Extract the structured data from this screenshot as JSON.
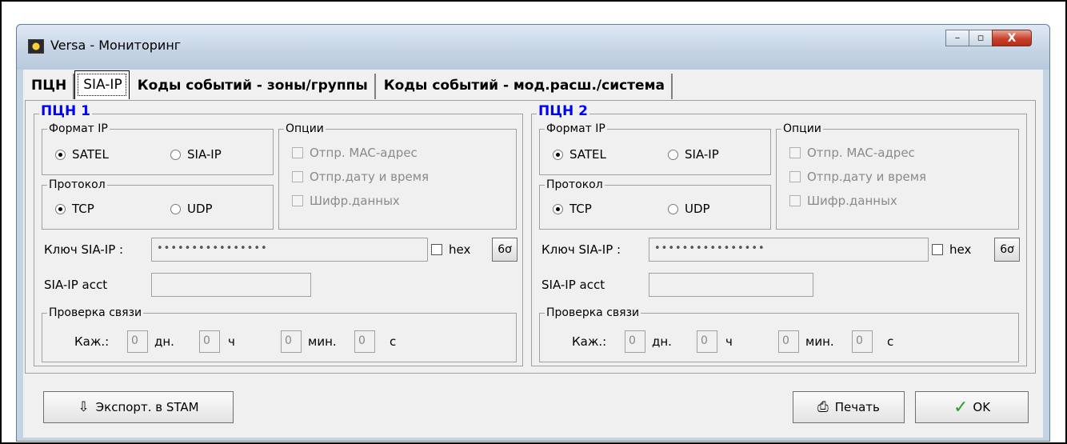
{
  "window": {
    "title": "Versa - Мониторинг",
    "minimize": "–",
    "maximize": "▫",
    "close": "X"
  },
  "tabs": [
    {
      "label": "ПЦН"
    },
    {
      "label": "SIA-IP"
    },
    {
      "label": "Коды событий - зоны/группы"
    },
    {
      "label": "Коды событий - мод.расш./система"
    }
  ],
  "stations": [
    {
      "title": "ПЦН 1",
      "format_group": "Формат IP",
      "format_options": [
        "SATEL",
        "SIA-IP"
      ],
      "protocol_group": "Протокол",
      "protocol_options": [
        "TCP",
        "UDP"
      ],
      "options_group": "Опции",
      "options": [
        "Отпр. MAC-адрес",
        "Отпр.дату и время",
        "Шифр.данных"
      ],
      "key_label": "Ключ SIA-IP :",
      "key_value": "••••••••••••••••",
      "hex_label": "hex",
      "view_button": "6ơ",
      "acct_label": "SIA-IP acct",
      "acct_value": "",
      "test_group": "Проверка связи",
      "every_label": "Каж.:",
      "days_value": "0",
      "days_unit": "дн.",
      "hours_value": "0",
      "hours_unit": "ч",
      "minutes_value": "0",
      "minutes_unit": "мин.",
      "seconds_value": "0",
      "seconds_unit": "с"
    },
    {
      "title": "ПЦН 2",
      "format_group": "Формат IP",
      "format_options": [
        "SATEL",
        "SIA-IP"
      ],
      "protocol_group": "Протокол",
      "protocol_options": [
        "TCP",
        "UDP"
      ],
      "options_group": "Опции",
      "options": [
        "Отпр. MAC-адрес",
        "Отпр.дату и время",
        "Шифр.данных"
      ],
      "key_label": "Ключ SIA-IP :",
      "key_value": "••••••••••••••••",
      "hex_label": "hex",
      "view_button": "6ơ",
      "acct_label": "SIA-IP acct",
      "acct_value": "",
      "test_group": "Проверка связи",
      "every_label": "Каж.:",
      "days_value": "0",
      "days_unit": "дн.",
      "hours_value": "0",
      "hours_unit": "ч",
      "minutes_value": "0",
      "minutes_unit": "мин.",
      "seconds_value": "0",
      "seconds_unit": "с"
    }
  ],
  "buttons": {
    "export": "Экспорт. в STAM",
    "print": "Печать",
    "ok": "OK"
  },
  "icons": {
    "export": "export-stam-icon",
    "print": "printer-icon",
    "ok": "checkmark-icon"
  },
  "colors": {
    "station_title": "#0000ff",
    "ok_check": "#2e9b28",
    "close_button": "#c9412b"
  }
}
